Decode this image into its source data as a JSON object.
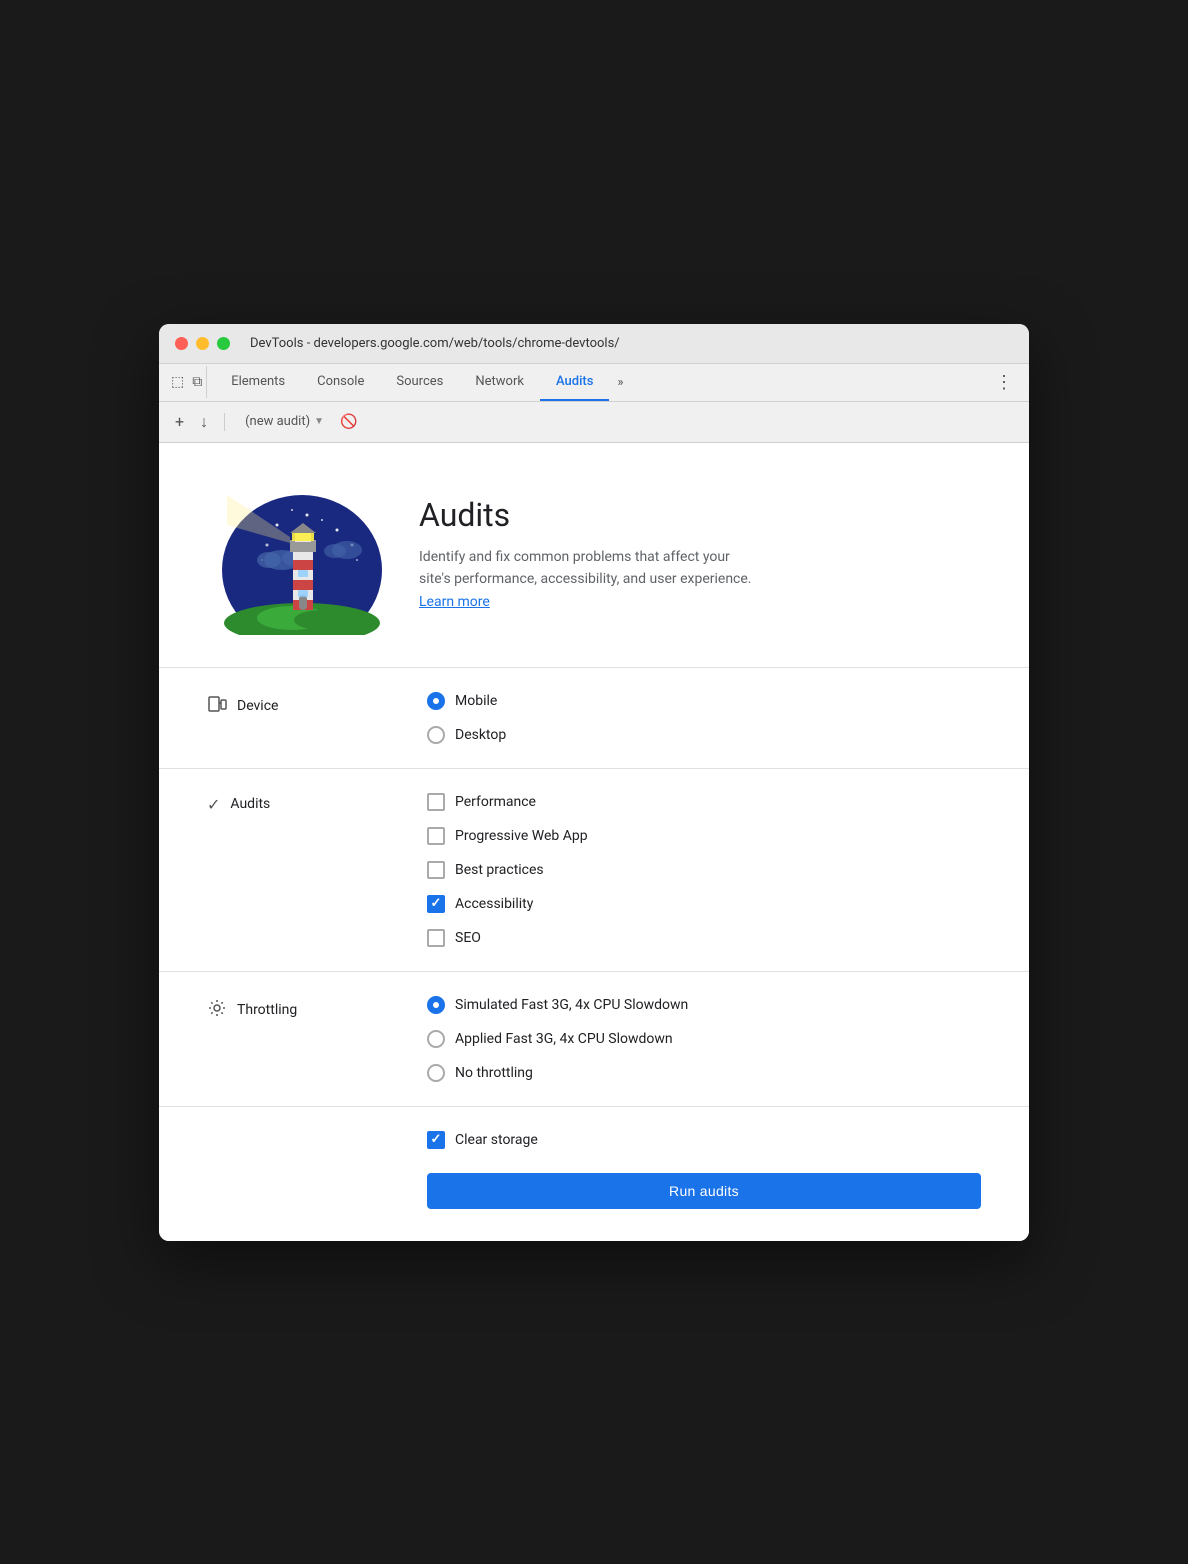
{
  "window": {
    "title": "DevTools - developers.google.com/web/tools/chrome-devtools/"
  },
  "tabs": {
    "items": [
      {
        "id": "elements",
        "label": "Elements",
        "active": false
      },
      {
        "id": "console",
        "label": "Console",
        "active": false
      },
      {
        "id": "sources",
        "label": "Sources",
        "active": false
      },
      {
        "id": "network",
        "label": "Network",
        "active": false
      },
      {
        "id": "audits",
        "label": "Audits",
        "active": true
      }
    ],
    "overflow_label": "»",
    "menu_label": "⋮"
  },
  "toolbar": {
    "new_audit_label": "(new audit)",
    "add_label": "+",
    "download_label": "↓"
  },
  "header": {
    "title": "Audits",
    "description": "Identify and fix common problems that affect your site's performance, accessibility, and user experience.",
    "learn_more_label": "Learn more"
  },
  "device": {
    "label": "Device",
    "options": [
      {
        "id": "mobile",
        "label": "Mobile",
        "checked": true
      },
      {
        "id": "desktop",
        "label": "Desktop",
        "checked": false
      }
    ]
  },
  "audits": {
    "label": "Audits",
    "options": [
      {
        "id": "performance",
        "label": "Performance",
        "checked": false
      },
      {
        "id": "pwa",
        "label": "Progressive Web App",
        "checked": false
      },
      {
        "id": "best-practices",
        "label": "Best practices",
        "checked": false
      },
      {
        "id": "accessibility",
        "label": "Accessibility",
        "checked": true
      },
      {
        "id": "seo",
        "label": "SEO",
        "checked": false
      }
    ]
  },
  "throttling": {
    "label": "Throttling",
    "options": [
      {
        "id": "simulated-fast-3g",
        "label": "Simulated Fast 3G, 4x CPU Slowdown",
        "checked": true
      },
      {
        "id": "applied-fast-3g",
        "label": "Applied Fast 3G, 4x CPU Slowdown",
        "checked": false
      },
      {
        "id": "no-throttling",
        "label": "No throttling",
        "checked": false
      }
    ]
  },
  "storage": {
    "label": "Clear storage",
    "checked": true
  },
  "run_button": {
    "label": "Run audits"
  }
}
